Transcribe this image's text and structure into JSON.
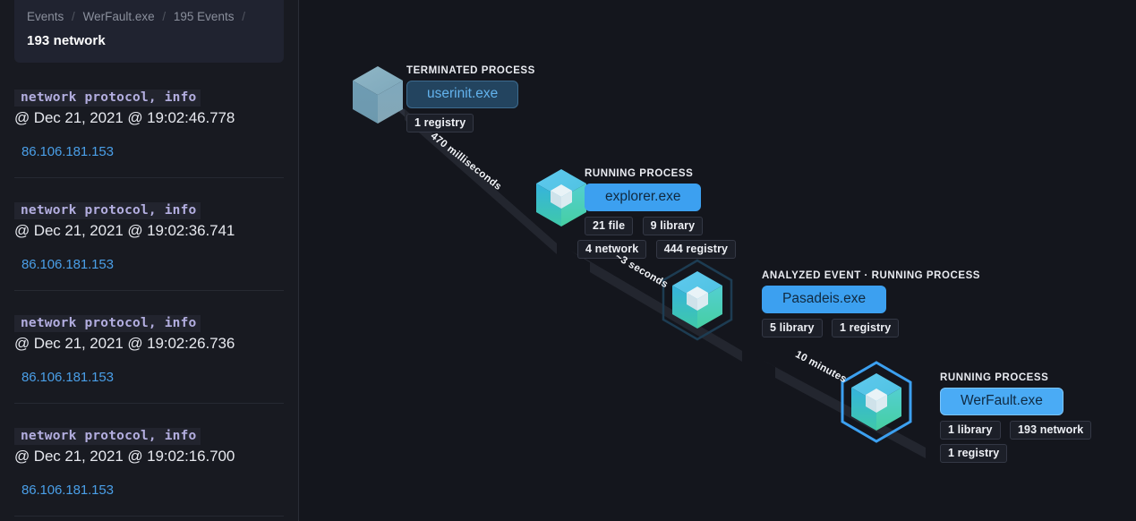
{
  "left_panel": {
    "breadcrumb": {
      "items": [
        "Events",
        "WerFault.exe",
        "195 Events"
      ],
      "separator": "/"
    },
    "title": "193 network",
    "events": [
      {
        "kind": "network protocol, info",
        "timestamp": "@ Dec 21, 2021 @ 19:02:46.778",
        "ip": "86.106.181.153"
      },
      {
        "kind": "network protocol, info",
        "timestamp": "@ Dec 21, 2021 @ 19:02:36.741",
        "ip": "86.106.181.153"
      },
      {
        "kind": "network protocol, info",
        "timestamp": "@ Dec 21, 2021 @ 19:02:26.736",
        "ip": "86.106.181.153"
      },
      {
        "kind": "network protocol, info",
        "timestamp": "@ Dec 21, 2021 @ 19:02:16.700",
        "ip": "86.106.181.153"
      }
    ],
    "scrollbar": {
      "arrow_icon": "chevron-up-icon"
    }
  },
  "graph": {
    "nodes": [
      {
        "id": "userinit",
        "kind": "TERMINATED PROCESS",
        "name": "userinit.exe",
        "state": "terminated",
        "pills": [
          "1 registry"
        ],
        "cube_icon": "process-cube-icon"
      },
      {
        "id": "explorer",
        "kind": "RUNNING PROCESS",
        "name": "explorer.exe",
        "state": "running",
        "pills": [
          "21 file",
          "9 library",
          "4 network",
          "444 registry"
        ],
        "cube_icon": "process-cube-icon"
      },
      {
        "id": "pasadeis",
        "kind": "ANALYZED EVENT · RUNNING PROCESS",
        "name": "Pasadeis.exe",
        "state": "analyzed",
        "pills": [
          "5 library",
          "1 registry"
        ],
        "cube_icon": "process-cube-icon"
      },
      {
        "id": "werfault",
        "kind": "RUNNING PROCESS",
        "name": "WerFault.exe",
        "state": "selected",
        "pills": [
          "1 library",
          "193 network",
          "1 registry"
        ],
        "cube_icon": "process-cube-icon"
      }
    ],
    "edges": [
      {
        "from": "userinit",
        "to": "explorer",
        "label": "470 milliseconds"
      },
      {
        "from": "explorer",
        "to": "pasadeis",
        "label": "~3 seconds"
      },
      {
        "from": "pasadeis",
        "to": "werfault",
        "label": "10 minutes"
      }
    ]
  },
  "colors": {
    "background": "#14161d",
    "panel": "#181a21",
    "accent_blue": "#3ca0f0",
    "link_blue": "#4a9fe8",
    "kind_purple": "#b3aee0",
    "cube_running_top": "#5cc8e8",
    "cube_running_side": "#3ec9a7",
    "cube_terminated": "#7d9cb0"
  }
}
